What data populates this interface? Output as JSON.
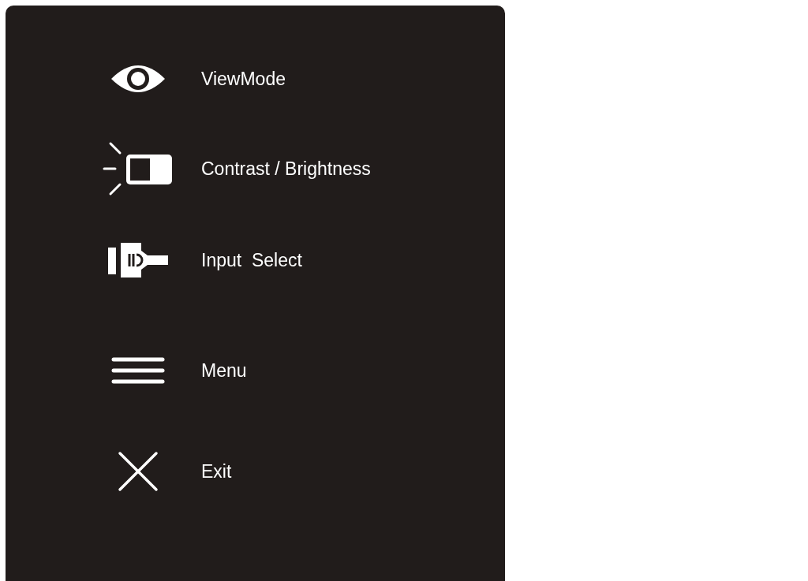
{
  "menu_items": [
    {
      "kind": "view_mode",
      "label": "ViewMode"
    },
    {
      "kind": "contrast",
      "label": "Contrast / Brightness"
    },
    {
      "kind": "input",
      "label": "Input  Select"
    },
    {
      "kind": "menu",
      "label": "Menu"
    },
    {
      "kind": "exit",
      "label": "Exit"
    }
  ]
}
